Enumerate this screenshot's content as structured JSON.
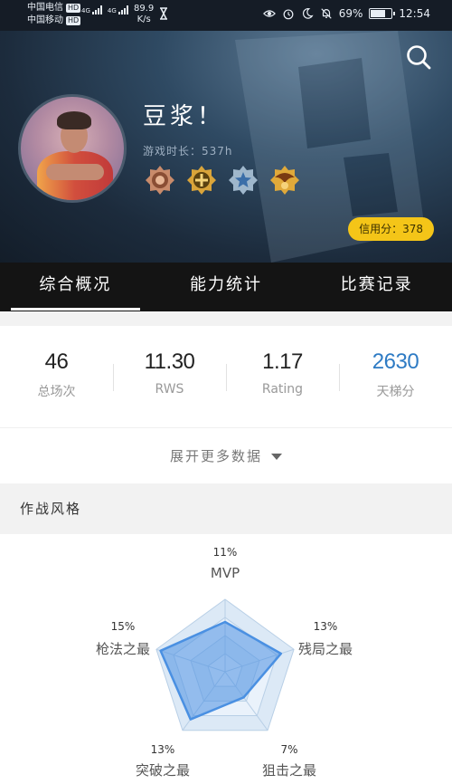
{
  "status_bar": {
    "carrier1": "中国电信",
    "carrier2": "中国移动",
    "hd": "HD",
    "net1": "4G",
    "net2": "4G",
    "speed_value": "89.9",
    "speed_unit": "K/s",
    "battery": "69%",
    "time": "12:54"
  },
  "profile": {
    "name": "豆浆！",
    "playtime": "游戏时长：537h",
    "credit": "信用分：378",
    "badges": [
      "bronze-badge-icon",
      "gold-badge-icon",
      "silver-star-badge-icon",
      "eagle-badge-icon"
    ]
  },
  "tabs": [
    {
      "label": "综合概况",
      "active": true
    },
    {
      "label": "能力统计",
      "active": false
    },
    {
      "label": "比赛记录",
      "active": false
    }
  ],
  "stats": [
    {
      "value": "46",
      "label": "总场次"
    },
    {
      "value": "11.30",
      "label": "RWS"
    },
    {
      "value": "1.17",
      "label": "Rating"
    },
    {
      "value": "2630",
      "label": "天梯分"
    }
  ],
  "expand_label": "展开更多数据",
  "style_section": {
    "title": "作战风格",
    "radar": [
      {
        "label": "MVP",
        "pct": "11%",
        "value": 11
      },
      {
        "label": "残局之最",
        "pct": "13%",
        "value": 13
      },
      {
        "label": "狙击之最",
        "pct": "7%",
        "value": 7
      },
      {
        "label": "突破之最",
        "pct": "13%",
        "value": 13
      },
      {
        "label": "枪法之最",
        "pct": "15%",
        "value": 15
      }
    ]
  },
  "colors": {
    "accent_blue": "#2e7bc4",
    "credit_yellow": "#f4c518",
    "radar_fill": "#4a90e2"
  }
}
